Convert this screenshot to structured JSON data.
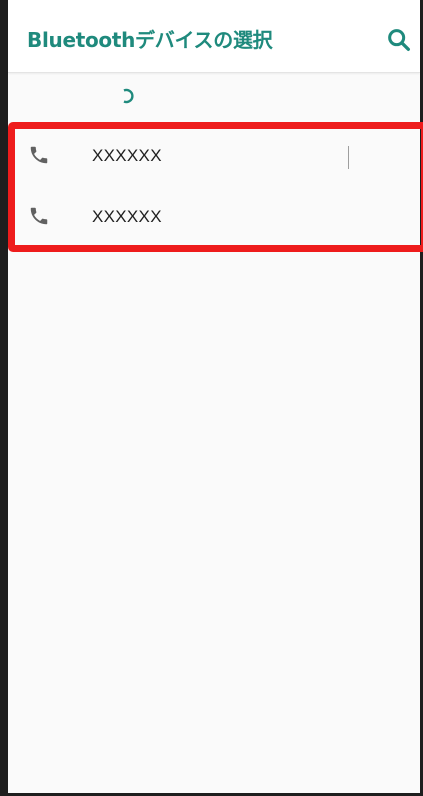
{
  "app_bar": {
    "title": "Bluetoothデバイスの選択",
    "search_icon": "search-icon"
  },
  "scanning": {
    "icon": "progress-spinner-icon"
  },
  "devices": [
    {
      "name": "XXXXXX",
      "icon": "phone-icon"
    },
    {
      "name": "XXXXXX",
      "icon": "phone-icon"
    }
  ],
  "colors": {
    "accent": "#1f8a7d",
    "highlight": "#ee1c1c",
    "text": "#212121",
    "icon": "#616161"
  }
}
